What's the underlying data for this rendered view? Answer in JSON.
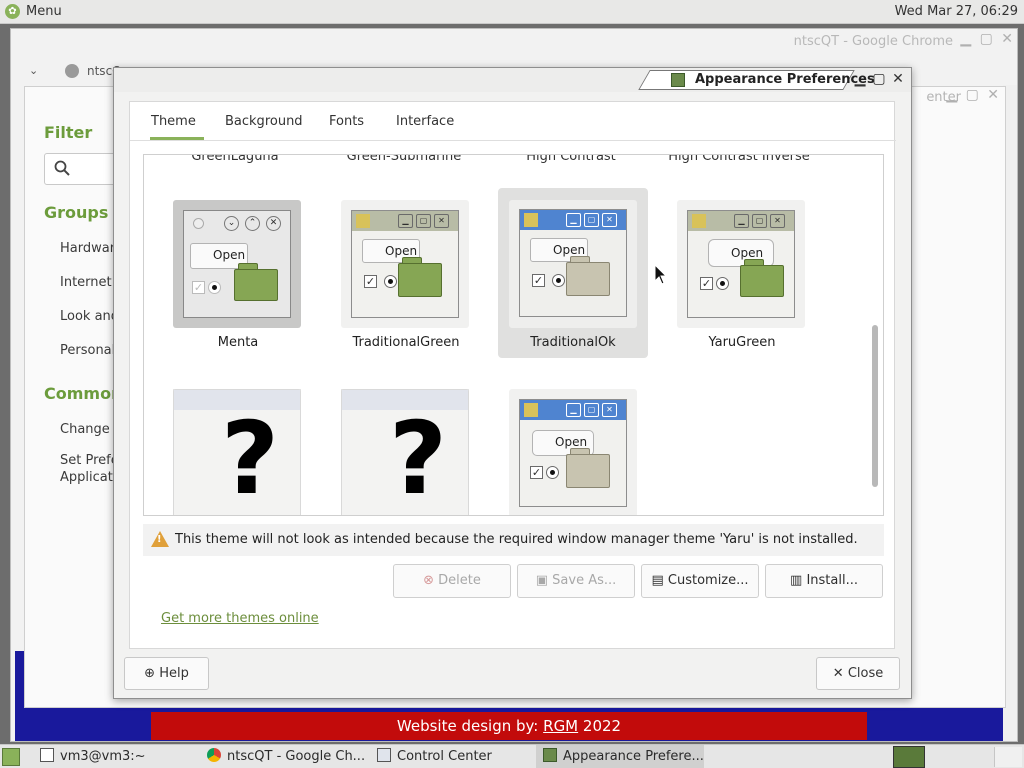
{
  "top_panel": {
    "menu_label": "Menu",
    "clock": "Wed Mar 27, 06:29"
  },
  "chrome": {
    "title": "ntscQT - Google Chrome",
    "tab_text": "ntscQ",
    "banner_prefix": "Website design by: ",
    "banner_link": "RGM",
    "banner_suffix": " 2022"
  },
  "control_center": {
    "title_fragment": "enter",
    "filter_label": "Filter",
    "groups_label": "Groups",
    "group_items": [
      "Hardware",
      "Internet a",
      "Look and",
      "Personal"
    ],
    "common_label": "Common T",
    "common_items": [
      "Change T",
      "Set Prefer",
      "Applicatio"
    ]
  },
  "appearance": {
    "title": "Appearance Preferences",
    "tabs": [
      "Theme",
      "Background",
      "Fonts",
      "Interface"
    ],
    "selected_tab": "Theme",
    "cut_off_labels": [
      "GreenLaguna",
      "Green-Submarine",
      "High Contrast",
      "High Contrast Inverse"
    ],
    "themes": [
      {
        "name": "Menta"
      },
      {
        "name": "TraditionalGreen"
      },
      {
        "name": "TraditionalOk",
        "selected": true
      },
      {
        "name": "YaruGreen"
      }
    ],
    "preview_open_label": "Open",
    "missing_preview_label": "?",
    "warning": "This theme will not look as intended because the required window manager theme 'Yaru' is not installed.",
    "buttons": {
      "delete": "Delete",
      "save_as": "Save As...",
      "customize": "Customize...",
      "install": "Install..."
    },
    "more_link": "Get more themes online",
    "help": "Help",
    "close": "Close"
  },
  "taskbar": {
    "items": [
      "vm3@vm3:~",
      "ntscQT - Google Ch...",
      "Control Center",
      "Appearance Prefere..."
    ]
  },
  "colors": {
    "accent": "#8ab25a",
    "banner_red": "#c20b0b",
    "banner_blue": "#19199c"
  }
}
